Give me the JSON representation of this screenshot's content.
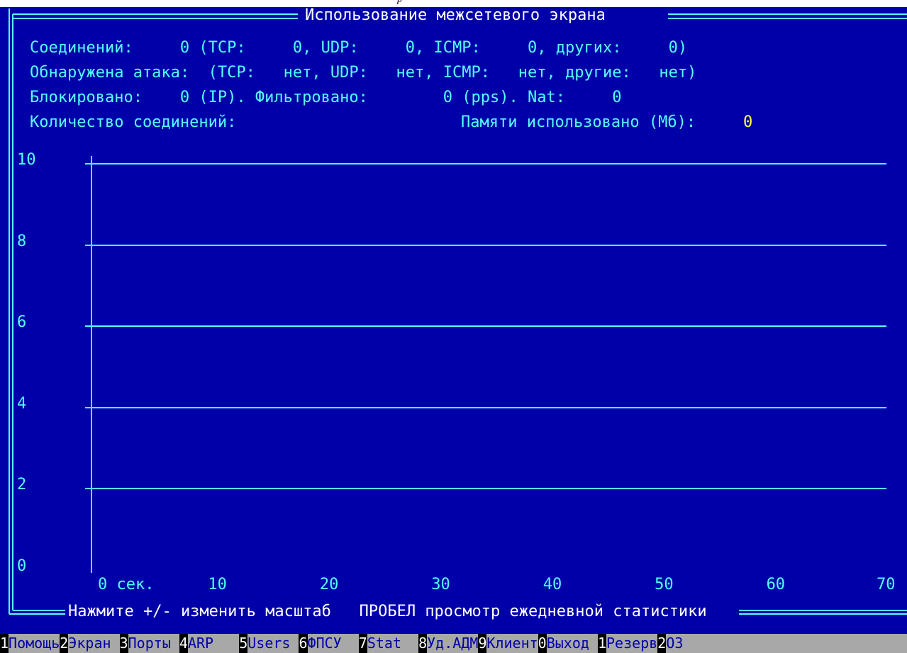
{
  "caption": "р",
  "window": {
    "title": "Использование межсетевого экрана",
    "footer": "Нажмите +/- изменить масштаб   ПРОБЕЛ просмотр ежедневной статистики"
  },
  "stats": {
    "line1": "Соединений:     0 (TCP:     0, UDP:     0, ICMP:     0, других:     0)",
    "line2": "Обнаружена атака:  (TCP:   нет, UDP:   нет, ICMP:   нет, другие:   нет)",
    "line3": "Блокировано:    0 (IP). Фильтровано:        0 (pps). Nat:     0",
    "line4_label": "Количество соединений:",
    "memory_label": "Памяти использовано (Мб):",
    "memory_value": "0"
  },
  "chart_data": {
    "type": "line",
    "title": "Количество соединений:",
    "y_ticks": [
      "10",
      "8",
      "6",
      "4",
      "2",
      "0"
    ],
    "x_ticks": [
      "0 сек.",
      "10",
      "20",
      "30",
      "40",
      "50",
      "60",
      "70"
    ],
    "ylim": [
      0,
      10
    ],
    "xlim": [
      0,
      70
    ],
    "series": [],
    "grid": true
  },
  "fkeys": [
    {
      "num": "1",
      "label": "Помощь"
    },
    {
      "num": "2",
      "label": "Экран "
    },
    {
      "num": "3",
      "label": "Порты "
    },
    {
      "num": "4",
      "label": "ARP   "
    },
    {
      "num": "5",
      "label": "Users "
    },
    {
      "num": "6",
      "label": "ФПСУ  "
    },
    {
      "num": "7",
      "label": "Stat  "
    },
    {
      "num": "8",
      "label": "Уд.АДМ"
    },
    {
      "num": "9",
      "label": "Клиент"
    },
    {
      "num": "0",
      "label": "Выход "
    },
    {
      "num": "1",
      "label": "Резерв"
    },
    {
      "num": "2",
      "label": "ОЗ"
    }
  ],
  "colors": {
    "background": "#0000a8",
    "text": "#55ffff",
    "highlight": "#ffff55",
    "menu_bg": "#a8a8a8"
  }
}
